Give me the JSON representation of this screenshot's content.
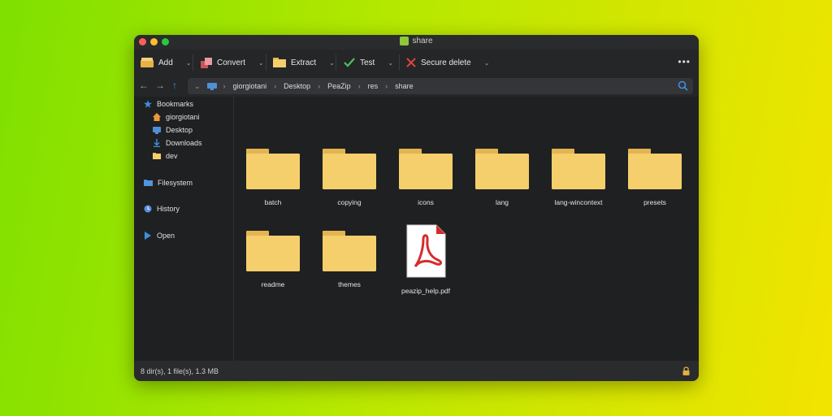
{
  "window": {
    "title": "share"
  },
  "toolbar": {
    "add_label": "Add",
    "convert_label": "Convert",
    "extract_label": "Extract",
    "test_label": "Test",
    "secure_delete_label": "Secure delete",
    "more_label": "•••"
  },
  "breadcrumb": [
    "giorgiotani",
    "Desktop",
    "PeaZip",
    "res",
    "share"
  ],
  "sidebar": {
    "bookmarks_label": "Bookmarks",
    "bookmarks": [
      "giorgiotani",
      "Desktop",
      "Downloads",
      "dev"
    ],
    "filesystem_label": "Filesystem",
    "history_label": "History",
    "open_label": "Open"
  },
  "files": [
    {
      "name": "batch",
      "type": "folder"
    },
    {
      "name": "copying",
      "type": "folder"
    },
    {
      "name": "icons",
      "type": "folder"
    },
    {
      "name": "lang",
      "type": "folder"
    },
    {
      "name": "lang-wincontext",
      "type": "folder"
    },
    {
      "name": "presets",
      "type": "folder"
    },
    {
      "name": "readme",
      "type": "folder"
    },
    {
      "name": "themes",
      "type": "folder"
    },
    {
      "name": "peazip_help.pdf",
      "type": "pdf"
    }
  ],
  "status": {
    "text": "8 dir(s), 1 file(s), 1.3 MB"
  },
  "colors": {
    "folder": "#f4cf6b",
    "folder_tab": "#e3b451",
    "pdf_red": "#d62b2b"
  }
}
